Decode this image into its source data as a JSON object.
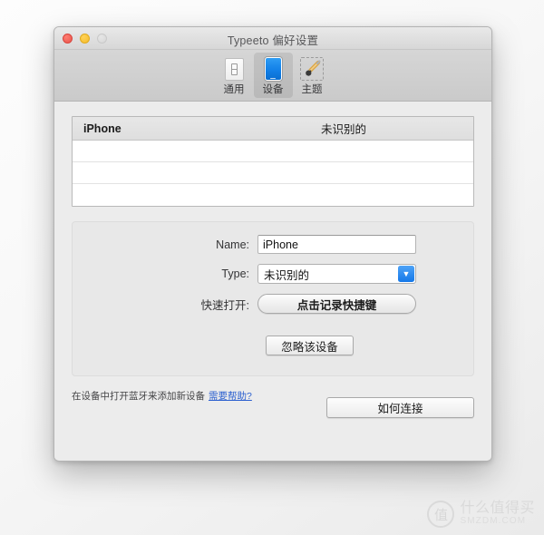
{
  "window": {
    "title": "Typeeto 偏好设置",
    "traffic_lights": [
      {
        "name": "close",
        "color": "#e8554b"
      },
      {
        "name": "minimize",
        "color": "#f5bc2b"
      },
      {
        "name": "zoom",
        "color": "#d6d6d6"
      }
    ]
  },
  "toolbar": {
    "tabs": [
      {
        "label": "通用",
        "icon": "light-switch-icon",
        "selected": false
      },
      {
        "label": "设备",
        "icon": "tablet-icon",
        "selected": true
      },
      {
        "label": "主题",
        "icon": "paintbrush-icon",
        "selected": false
      }
    ]
  },
  "device_table": {
    "columns": [
      "iPhone",
      "未识别的"
    ],
    "rows": [
      {
        "name": "",
        "status": ""
      },
      {
        "name": "",
        "status": ""
      },
      {
        "name": "",
        "status": ""
      }
    ]
  },
  "settings": {
    "name_label": "Name:",
    "name_value": "iPhone",
    "name_placeholder": "",
    "type_label": "Type:",
    "type_value": "未识别的",
    "type_options": [
      "未识别的"
    ],
    "hotkey_label": "快速打开:",
    "hotkey_button": "点击记录快捷键",
    "forget_button": "忽略该设备"
  },
  "footer": {
    "hint": "在设备中打开蓝牙来添加新设备",
    "help_link": "需要帮助?",
    "connect_button": "如何连接"
  },
  "watermark": {
    "badge": "值",
    "chinese": "什么值得买",
    "english": "SMZDM.COM"
  },
  "colors": {
    "accent_blue": "#1578e8",
    "link_blue": "#2b5fcf",
    "window_bg": "#ececec",
    "panel_bg": "#e8e8e8"
  }
}
